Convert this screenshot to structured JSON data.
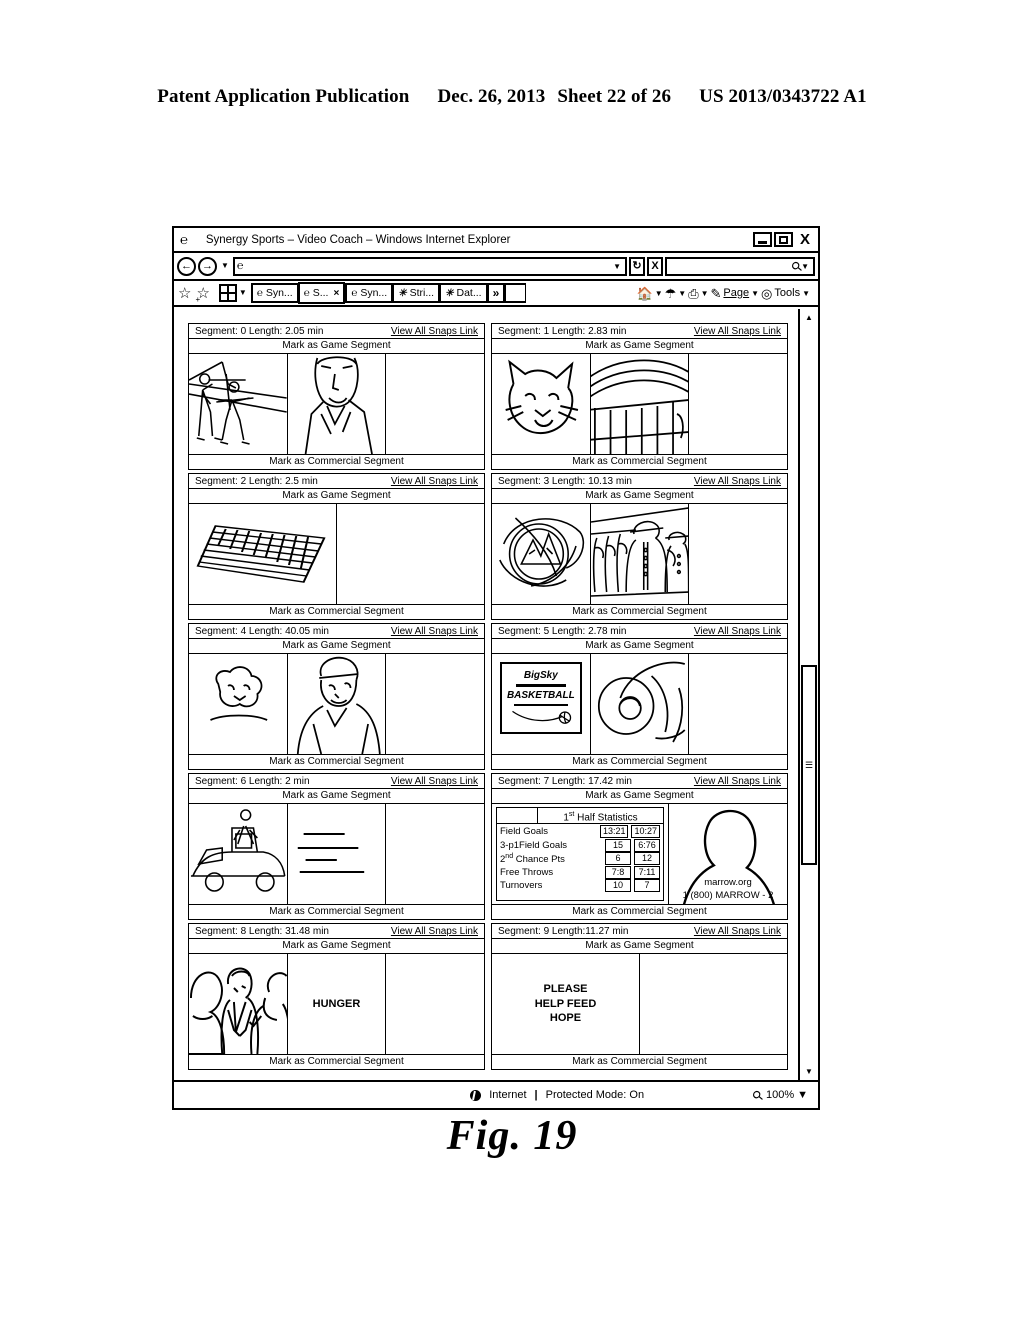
{
  "patent_header": {
    "publication": "Patent Application Publication",
    "date": "Dec. 26, 2013",
    "sheet": "Sheet 22 of 26",
    "number": "US 2013/0343722 A1"
  },
  "figure_caption": "Fig. 19",
  "browser": {
    "title": "Synergy Sports – Video Coach – Windows Internet Explorer",
    "window_buttons": {
      "minimize": "",
      "maximize": "",
      "close": "X"
    },
    "address": {
      "value": "",
      "placeholder": ""
    },
    "search": {
      "value": "",
      "placeholder": ""
    },
    "nav": {
      "back": "←",
      "forward": "→"
    },
    "tabs": [
      {
        "label": "Syn...",
        "active": false
      },
      {
        "label": "S...",
        "active": true,
        "close": "×"
      },
      {
        "label": "Syn...",
        "active": false
      },
      {
        "label": "Stri...",
        "active": false
      },
      {
        "label": "Dat...",
        "active": false
      },
      {
        "label": "»",
        "active": false
      }
    ],
    "command_bar": {
      "page": "Page",
      "tools": "Tools"
    },
    "status": {
      "zone": "Internet",
      "separator": "|",
      "protected_mode": "Protected Mode: On",
      "zoom": "100%"
    }
  },
  "labels": {
    "mark_game": "Mark as Game Segment",
    "mark_commercial": "Mark as Commercial Segment",
    "view_all_snaps": "View All Snaps Link"
  },
  "segments": [
    {
      "id": "0",
      "header": "Segment: 0 Length: 2.05 min",
      "thumbs": [
        "people-carrying-cross",
        "man-portrait",
        "blank"
      ]
    },
    {
      "id": "1",
      "header": "Segment: 1 Length: 2.83 min",
      "thumbs": [
        "cougar-mascot",
        "stadium-arch",
        "blank"
      ]
    },
    {
      "id": "2",
      "header": "Segment: 2 Length: 2.5 min",
      "thumbs": [
        "grid-mat",
        "blank"
      ]
    },
    {
      "id": "3",
      "header": "Segment: 3 Length: 10.13 min",
      "thumbs": [
        "mountain-emblem",
        "marching-band",
        "blank"
      ]
    },
    {
      "id": "4",
      "header": "Segment: 4 Length: 40.05 min",
      "thumbs": [
        "lamb-sketch",
        "person-headband",
        "blank"
      ]
    },
    {
      "id": "5",
      "header": "Segment: 5 Length: 2.78 min",
      "thumbs": [
        "bigsky-sign",
        "swirl-circle",
        "blank"
      ]
    },
    {
      "id": "6",
      "header": "Segment: 6 Length: 2 min",
      "thumbs": [
        "car-and-person",
        "lines-sketch",
        "blank"
      ]
    },
    {
      "id": "7",
      "header": "Segment: 7 Length: 17.42 min",
      "thumbs": [
        "half-statistics",
        "marrow-silhouette"
      ]
    },
    {
      "id": "8",
      "header": "Segment: 8 Length: 31.48 min",
      "thumbs": [
        "three-people",
        "hunger-text",
        "blank"
      ]
    },
    {
      "id": "9",
      "header": "Segment: 9 Length:11.27 min",
      "thumbs": [
        "please-help-feed-hope",
        "blank"
      ]
    }
  ],
  "bigsky_sign": {
    "line1": "BigSky",
    "line2": "BASKETBALL"
  },
  "hunger_ad": {
    "text": "HUNGER"
  },
  "hope_ad": {
    "line1": "PLEASE",
    "line2": "HELP FEED",
    "line3": "HOPE"
  },
  "marrow_ad": {
    "site": "marrow.org",
    "phone": "1 (800) MARROW - 2"
  },
  "half_statistics": {
    "title_prefix": "1",
    "title_sup": "st",
    "title_suffix": " Half Statistics",
    "rows": [
      {
        "name": "Field Goals",
        "name_sup": "",
        "home": "13:21",
        "away": "10:27"
      },
      {
        "name": "3-p1Field Goals",
        "name_sup": "",
        "home": "15",
        "away": "6:76"
      },
      {
        "name": "2",
        "name_sup": "nd",
        "name_tail": " Chance Pts",
        "home": "6",
        "away": "12"
      },
      {
        "name": "Free Throws",
        "name_sup": "",
        "home": "7:8",
        "away": "7:11"
      },
      {
        "name": "Turnovers",
        "name_sup": "",
        "home": "10",
        "away": "7"
      }
    ]
  }
}
